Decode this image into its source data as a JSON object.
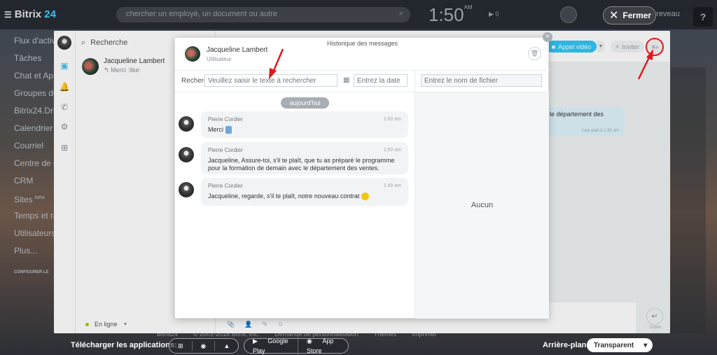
{
  "portal": {
    "logo": "Bitrix",
    "logo_num": "24",
    "search_placeholder": "chercher un employé, un document ou autre",
    "clock": "1:50",
    "clock_ampm": "AM",
    "play": "▶ 0",
    "return_label": "etre à reveau",
    "close_label": "Fermer",
    "help": "?",
    "menu": [
      "Flux d'activ",
      "Tâches",
      "Chat et Ap",
      "Groupes de",
      "Bitrix24.Dri",
      "Calendrier",
      "Courriel",
      "Centre de co",
      "CRM",
      "Sites",
      "Temps et ra",
      "Utilisateurs",
      "Plus..."
    ],
    "menu_sites_badge": "beta",
    "configure": "CONFIGURER LE",
    "footer": [
      "Bitrix24",
      "© 2001-2018 Bitrix, Inc.",
      "Demande de personnalisation",
      "Thèmes",
      "Imprimer"
    ]
  },
  "sidebar": {
    "search_label": "Recherche",
    "recent": {
      "name": "Jacqueline Lambert",
      "last_message": "Merci :like:"
    },
    "status": "En ligne"
  },
  "chat": {
    "video_call": "Appel vidéo",
    "invite": "Inviter",
    "bubble_text": "c le département des",
    "bubble_meta": "Cela plaît à   1:50 am",
    "send_label": "Entrer"
  },
  "history": {
    "title": "Historique des messages",
    "user_name": "Jacqueline Lambert",
    "user_role": "Utilisateur",
    "search_label": "Recherche",
    "search_placeholder": "Veuillez saisir le texte à rechercher",
    "date_placeholder": "Entrez la date",
    "file_placeholder": "Entrez le nom de fichier",
    "date_chip": "aujourd'hui",
    "files_empty": "Aucun",
    "messages": [
      {
        "author": "Pierre Cordier",
        "time": "1:50 am",
        "text": "Merci"
      },
      {
        "author": "Pierre Cordier",
        "time": "1:50 am",
        "text": "Jacqueline, Assure-toi, s'il te plaît, que tu as préparé le programme pour la formation de demain avec le département des ventes."
      },
      {
        "author": "Pierre Cordier",
        "time": "1:49 am",
        "text": "Jacqueline, regarde, s'il te plaît, notre nouveau contrat"
      }
    ]
  },
  "bottom": {
    "apps_label": "Télécharger les applications:",
    "google_play": "Google Play",
    "app_store": "App Store",
    "background_label": "Arrière-plan:",
    "background_value": "Transparent"
  },
  "colors": {
    "accent": "#2fc7f7",
    "annotation": "#e0191e",
    "online": "#9dcf00"
  }
}
